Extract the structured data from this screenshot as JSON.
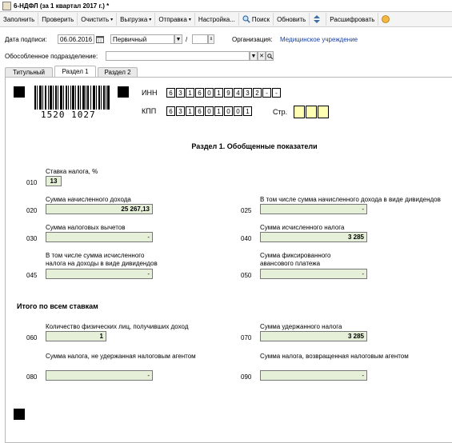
{
  "window": {
    "title": "6-НДФЛ (за 1 квартал 2017 г.) *"
  },
  "toolbar": {
    "fill": "Заполнить",
    "check": "Проверить",
    "clear": "Очистить",
    "export": "Выгрузка",
    "send": "Отправка",
    "settings": "Настройка...",
    "search": "Поиск",
    "refresh": "Обновить",
    "decode": "Расшифровать",
    "help": "?"
  },
  "header": {
    "sign_date_label": "Дата подписи:",
    "sign_date": "06.06.2016",
    "report_type": "Первичный",
    "correction_number": "",
    "slash": "/",
    "org_label": "Организация:",
    "org_value": "Медицинское учреждение",
    "subdivision_label": "Обособленное подразделение:",
    "subdivision_value": ""
  },
  "tabs": [
    "Титульный",
    "Раздел 1",
    "Раздел 2"
  ],
  "form": {
    "barcode_number": "1520 1027",
    "inn_label": "ИНН",
    "inn_cells": [
      "6",
      "3",
      "1",
      "6",
      "0",
      "1",
      "9",
      "4",
      "3",
      "2",
      "-",
      "-"
    ],
    "kpp_label": "КПП",
    "kpp_cells": [
      "6",
      "3",
      "1",
      "6",
      "0",
      "1",
      "0",
      "0",
      "1"
    ],
    "page_label": "Стр.",
    "page_cells": [
      "",
      "",
      ""
    ],
    "section_title": "Раздел 1. Обобщенные показатели",
    "rate_label": "Ставка налога, %",
    "rate_code": "010",
    "rate_value": "13",
    "lines": {
      "l020": {
        "code": "020",
        "label": "Сумма начисленного дохода",
        "value": "25 267,13"
      },
      "l025": {
        "code": "025",
        "label": "В том числе сумма начисленного дохода в виде дивидендов",
        "value": "-"
      },
      "l030": {
        "code": "030",
        "label": "Сумма налоговых вычетов",
        "value": "-"
      },
      "l040": {
        "code": "040",
        "label": "Сумма исчисленного налога",
        "value": "3 285"
      },
      "l045": {
        "code": "045",
        "label1": "В том числе сумма исчисленного",
        "label2": "налога на доходы в виде дивидендов",
        "value": "-"
      },
      "l050": {
        "code": "050",
        "label1": "Сумма фиксированного",
        "label2": "авансового платежа",
        "value": "-"
      }
    },
    "total_title": "Итого по всем ставкам",
    "totals": {
      "l060": {
        "code": "060",
        "label": "Количество физических лиц, получивших доход",
        "value": "1"
      },
      "l070": {
        "code": "070",
        "label": "Сумма удержанного налога",
        "value": "3 285"
      },
      "l080": {
        "code": "080",
        "label": "Сумма налога, не удержанная налоговым агентом",
        "value": "-"
      },
      "l090": {
        "code": "090",
        "label": "Сумма налога, возвращенная налоговым агентом",
        "value": "-"
      }
    }
  }
}
